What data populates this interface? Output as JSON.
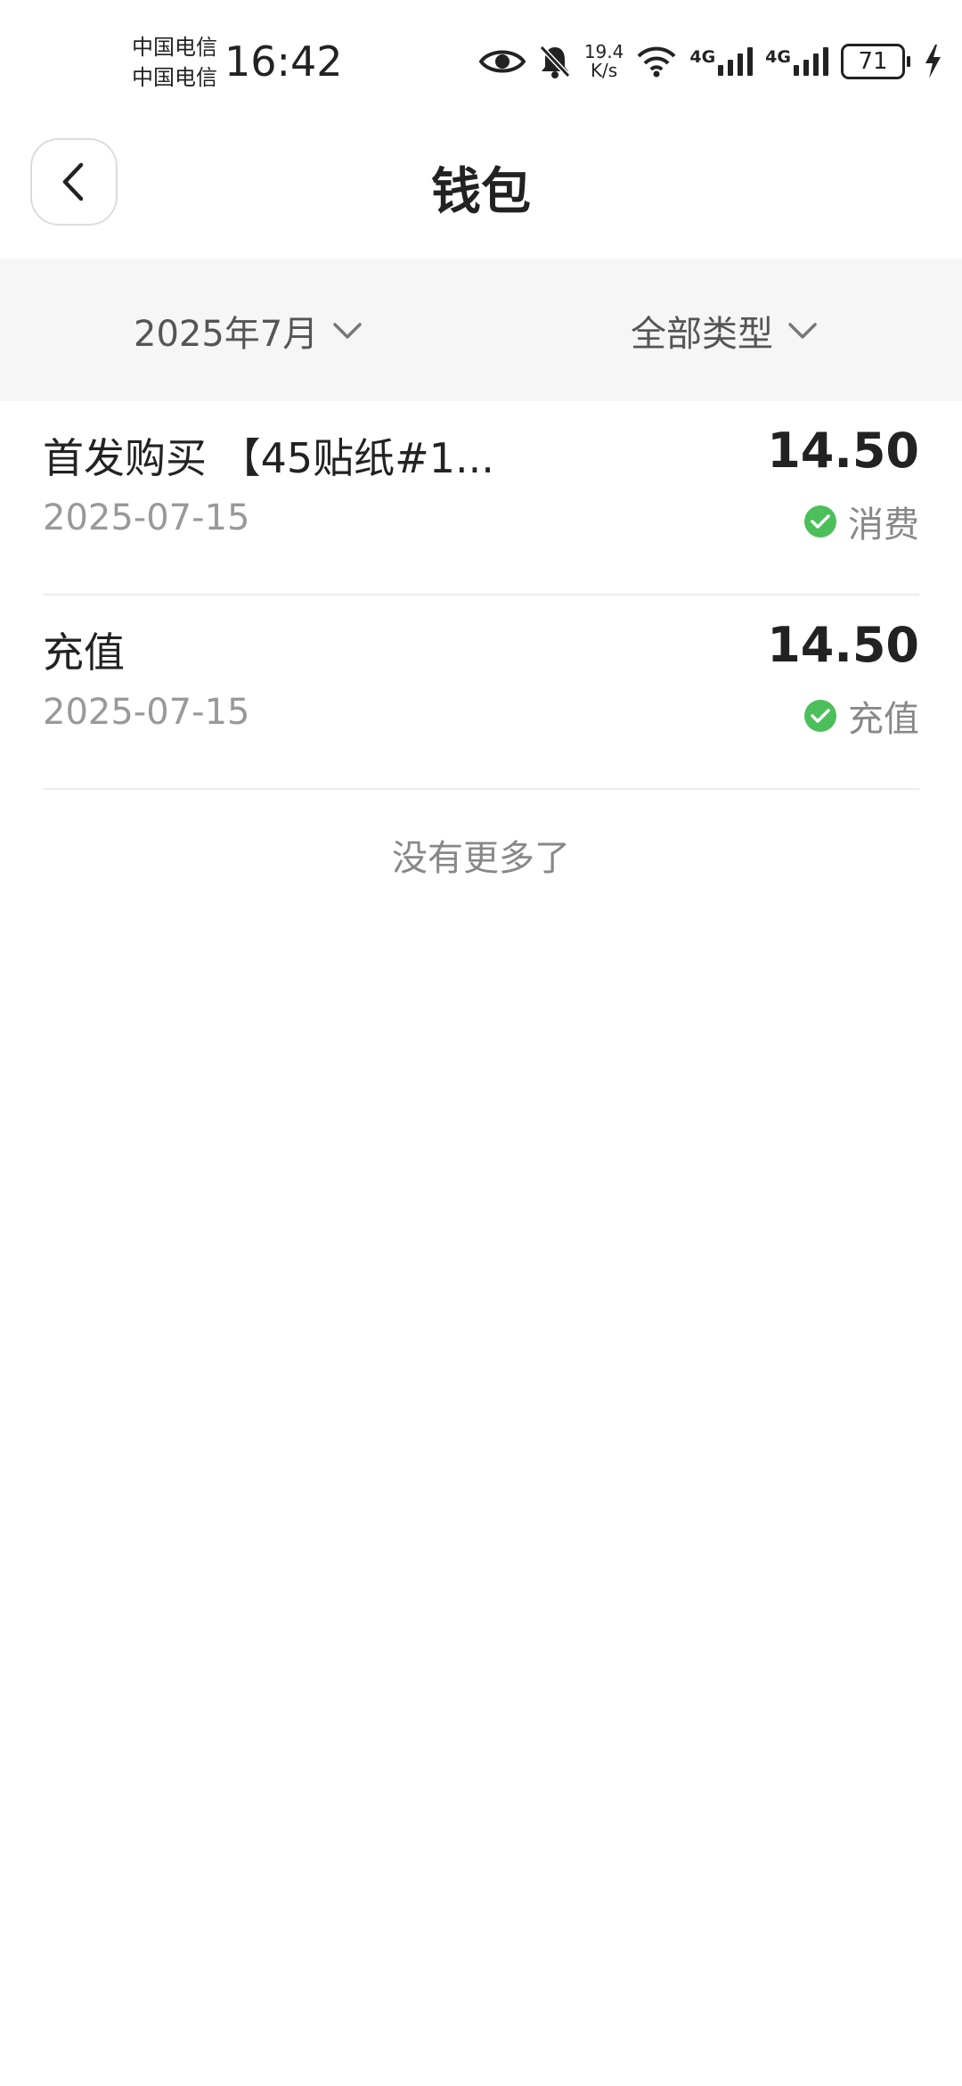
{
  "status_bar": {
    "carrier_1": "中国电信",
    "carrier_2": "中国电信",
    "time": "16:42",
    "net_speed_value": "19.4",
    "net_speed_unit": "K/s",
    "sim1_tag": "4G",
    "sim2_tag": "4G",
    "battery_level": "71"
  },
  "header": {
    "title": "钱包",
    "back_icon": "chevron-left-icon"
  },
  "filters": {
    "month": "2025年7月",
    "type": "全部类型"
  },
  "transactions": [
    {
      "title": "首发购买 【45贴纸#1...",
      "amount": "14.50",
      "date": "2025-07-15",
      "status": "消费"
    },
    {
      "title": "充值",
      "amount": "14.50",
      "date": "2025-07-15",
      "status": "充值"
    }
  ],
  "footer_text": "没有更多了",
  "colors": {
    "status_ok": "#4cbf5b",
    "filter_bg": "#f6f6f6",
    "divider": "#ececec"
  }
}
